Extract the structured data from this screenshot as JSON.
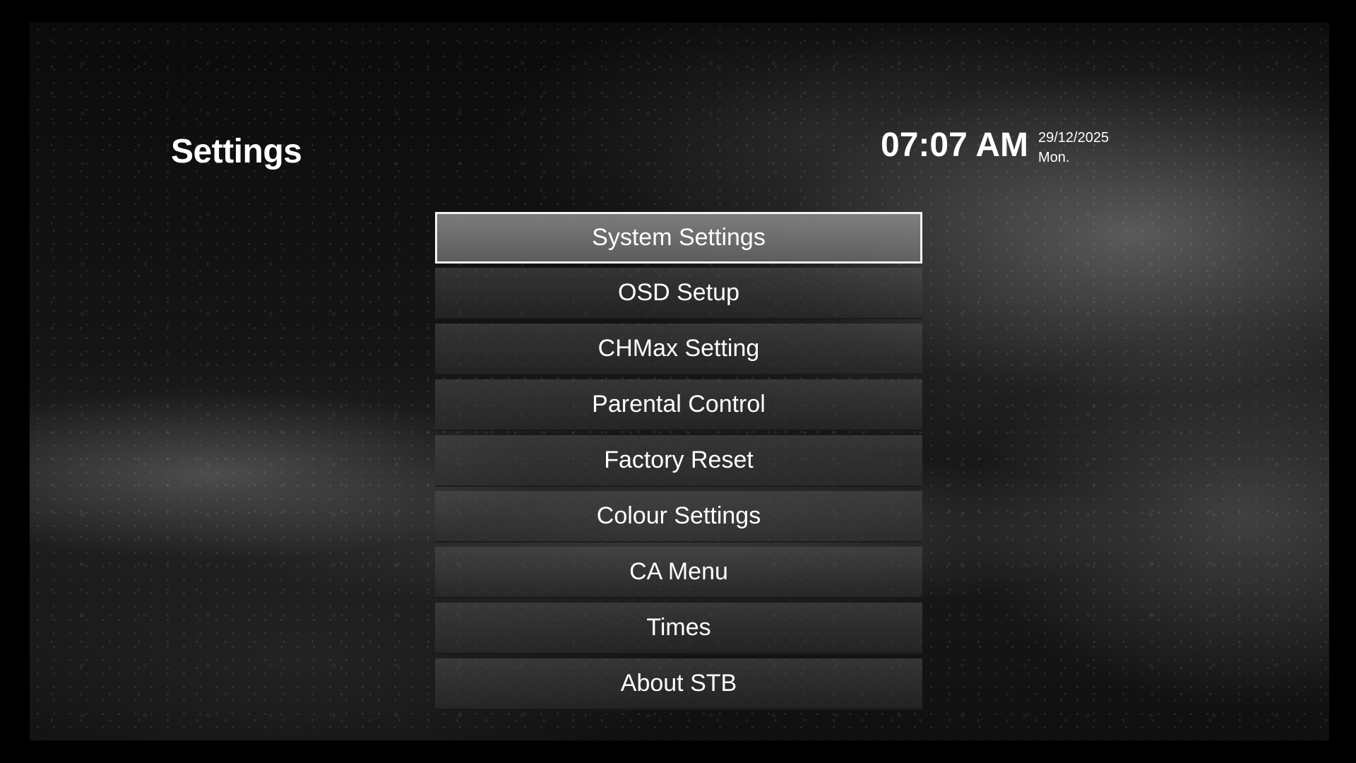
{
  "header": {
    "title": "Settings",
    "time": "07:07 AM",
    "date": "29/12/2025",
    "weekday": "Mon."
  },
  "menu": {
    "selected_index": 0,
    "items": [
      {
        "label": "System Settings"
      },
      {
        "label": "OSD Setup"
      },
      {
        "label": "CHMax Setting"
      },
      {
        "label": "Parental Control"
      },
      {
        "label": "Factory Reset"
      },
      {
        "label": "Colour Settings"
      },
      {
        "label": "CA Menu"
      },
      {
        "label": "Times"
      },
      {
        "label": "About STB"
      }
    ]
  },
  "colors": {
    "text": "#ffffff",
    "selection_border": "#f2f2f2",
    "background": "#000000"
  }
}
